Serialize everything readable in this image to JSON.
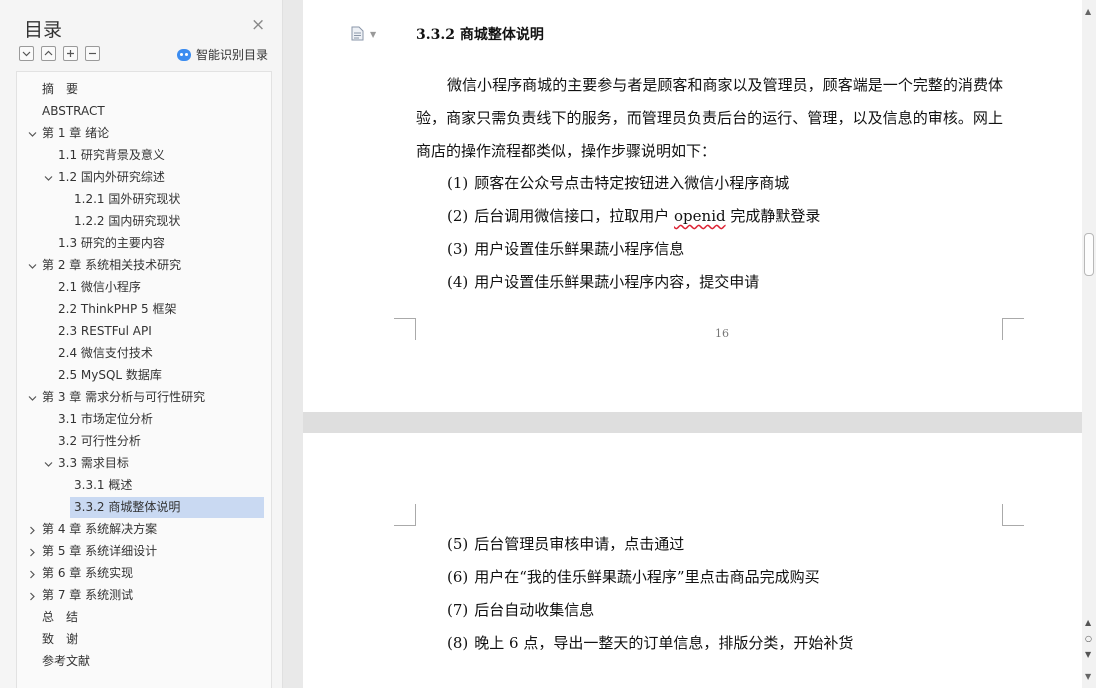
{
  "nav": {
    "title": "目录",
    "close": "×",
    "smart_toc_label": "智能识别目录",
    "toc": [
      {
        "label": "摘　要",
        "indent": 0,
        "chevron": ""
      },
      {
        "label": "ABSTRACT",
        "indent": 0,
        "chevron": ""
      },
      {
        "label": "第 1 章  绪论",
        "indent": 0,
        "chevron": "down"
      },
      {
        "label": "1.1  研究背景及意义",
        "indent": 1,
        "chevron": ""
      },
      {
        "label": "1.2  国内外研究综述",
        "indent": 1,
        "chevron": "down"
      },
      {
        "label": "1.2.1 国外研究现状",
        "indent": 2,
        "chevron": ""
      },
      {
        "label": "1.2.2 国内研究现状",
        "indent": 2,
        "chevron": ""
      },
      {
        "label": "1.3  研究的主要内容",
        "indent": 1,
        "chevron": ""
      },
      {
        "label": "第 2 章  系统相关技术研究",
        "indent": 0,
        "chevron": "down"
      },
      {
        "label": "2.1  微信小程序",
        "indent": 1,
        "chevron": ""
      },
      {
        "label": "2.2 ThinkPHP 5  框架",
        "indent": 1,
        "chevron": ""
      },
      {
        "label": "2.3 RESTFul API",
        "indent": 1,
        "chevron": ""
      },
      {
        "label": "2.4  微信支付技术",
        "indent": 1,
        "chevron": ""
      },
      {
        "label": "2.5 MySQL 数据库",
        "indent": 1,
        "chevron": ""
      },
      {
        "label": "第 3 章  需求分析与可行性研究",
        "indent": 0,
        "chevron": "down"
      },
      {
        "label": "3.1  市场定位分析",
        "indent": 1,
        "chevron": ""
      },
      {
        "label": "3.2  可行性分析",
        "indent": 1,
        "chevron": ""
      },
      {
        "label": "3.3  需求目标",
        "indent": 1,
        "chevron": "down"
      },
      {
        "label": "3.3.1  概述",
        "indent": 2,
        "chevron": ""
      },
      {
        "label": "3.3.2  商城整体说明",
        "indent": 2,
        "chevron": "",
        "selected": true
      },
      {
        "label": "第 4 章  系统解决方案",
        "indent": 0,
        "chevron": "right"
      },
      {
        "label": "第 5 章  系统详细设计",
        "indent": 0,
        "chevron": "right"
      },
      {
        "label": "第 6 章  系统实现",
        "indent": 0,
        "chevron": "right"
      },
      {
        "label": "第 7 章  系统测试",
        "indent": 0,
        "chevron": "right"
      },
      {
        "label": "总　结",
        "indent": 0,
        "chevron": ""
      },
      {
        "label": "致　谢",
        "indent": 0,
        "chevron": ""
      },
      {
        "label": "参考文献",
        "indent": 0,
        "chevron": ""
      }
    ]
  },
  "doc": {
    "heading": "3.3.2  商城整体说明",
    "paragraph": "微信小程序商城的主要参与者是顾客和商家以及管理员，顾客端是一个完整的消费体验，商家只需负责线下的服务，而管理员负责后台的运行、管理，以及信息的审核。网上商店的操作流程都类似，操作步骤说明如下：",
    "page_number": "16",
    "list_page1": [
      {
        "num": "(1)",
        "text": "顾客在公众号点击特定按钮进入微信小程序商城"
      },
      {
        "num": "(2)",
        "text_before": "后台调用微信接口，拉取用户 ",
        "text_underlined": "openid",
        "text_after": " 完成静默登录"
      },
      {
        "num": "(3)",
        "text": "用户设置佳乐鲜果蔬小程序信息"
      },
      {
        "num": "(4)",
        "text": "用户设置佳乐鲜果蔬小程序内容，提交申请"
      }
    ],
    "list_page2": [
      {
        "num": "(5)",
        "text": "后台管理员审核申请，点击通过"
      },
      {
        "num": "(6)",
        "text": "用户在“我的佳乐鲜果蔬小程序”里点击商品完成购买"
      },
      {
        "num": "(7)",
        "text": "后台自动收集信息"
      },
      {
        "num": "(8)",
        "text": "晚上 6 点，导出一整天的订单信息，排版分类，开始补货"
      }
    ]
  },
  "scrollbar": {
    "up": "▲",
    "down": "▼",
    "nav_buttons": [
      "▲",
      "○",
      "▼"
    ]
  }
}
